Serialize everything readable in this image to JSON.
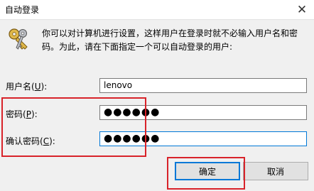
{
  "window": {
    "title": "自动登录",
    "close_glyph": "✕"
  },
  "description": {
    "line1": "你可以对计算机进行设置，这样用户在登录时就不必输入用户名和密",
    "line2": "码。为此，请在下面指定一个可以自动登录的用户:"
  },
  "form": {
    "username": {
      "label_pre": "用户名(",
      "accel": "U",
      "label_post": "):",
      "value": "lenovo"
    },
    "password": {
      "label_pre": "密码(",
      "accel": "P",
      "label_post": "):",
      "value": "●●●●●●"
    },
    "confirm": {
      "label_pre": "确认密码(",
      "accel": "C",
      "label_post": "):",
      "value": "●●●●●●"
    }
  },
  "buttons": {
    "ok": "确定",
    "cancel": "取消"
  },
  "colors": {
    "highlight": "#d8232a",
    "focus": "#0078d7"
  }
}
